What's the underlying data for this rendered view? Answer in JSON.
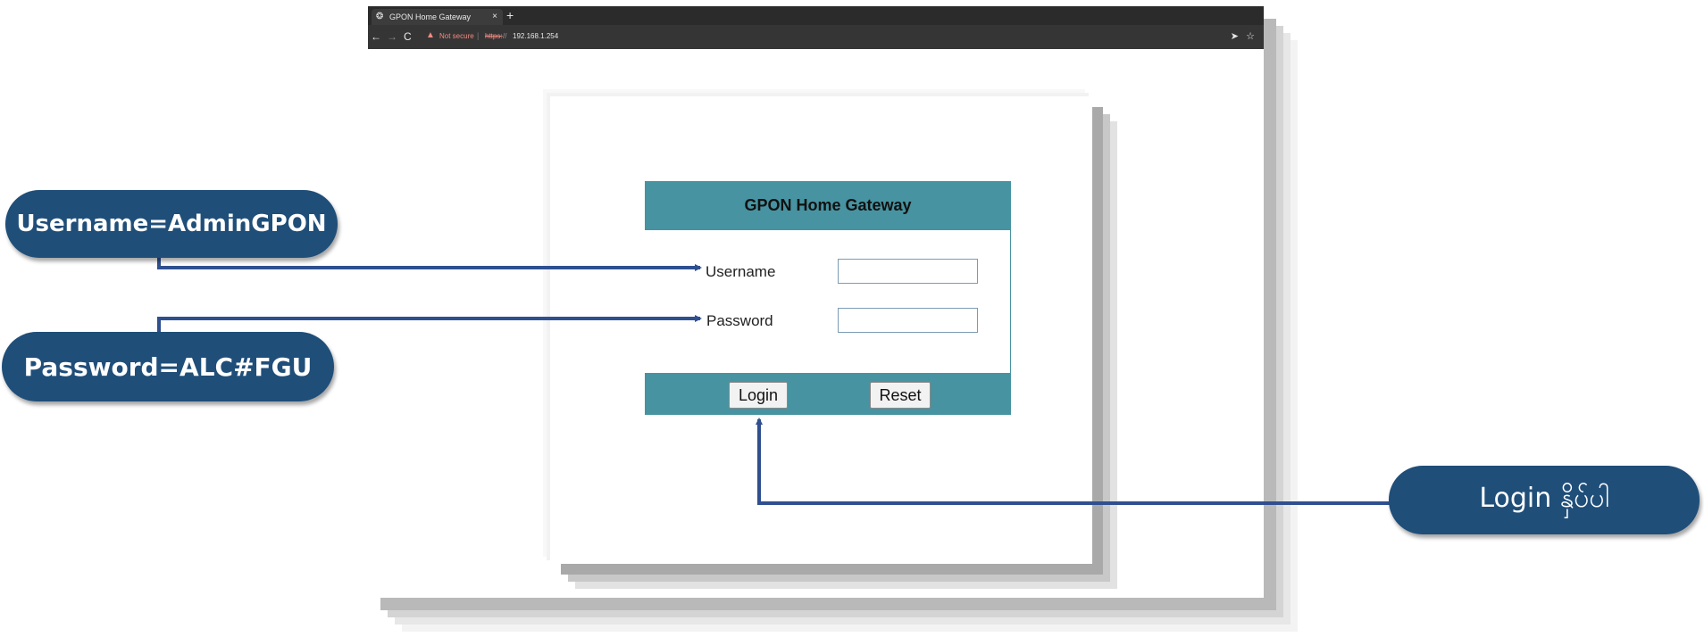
{
  "browser": {
    "tab_title": "GPON Home Gateway",
    "tab_close": "×",
    "new_tab": "+",
    "not_secure": "Not secure",
    "url_separator": "|",
    "url_scheme": "https:",
    "url_slashes": "//",
    "url_host": "192.168.1.254",
    "icons": {
      "back": "←",
      "forward": "→",
      "reload": "C",
      "warning": "▲",
      "share": "➤",
      "star": "☆",
      "tab_globe": "❂"
    }
  },
  "login": {
    "header": "GPON Home Gateway",
    "username_label": "Username",
    "password_label": "Password",
    "username_value": "",
    "password_value": "",
    "login_button": "Login",
    "reset_button": "Reset"
  },
  "callouts": {
    "username": "Username=AdminGPON",
    "password": "Password=ALC#FGU",
    "login": "Login နှိပ်ပါ"
  },
  "colors": {
    "header_bar": "#4793a1",
    "callout": "#1f4e79",
    "connector": "#2f4f8f"
  }
}
